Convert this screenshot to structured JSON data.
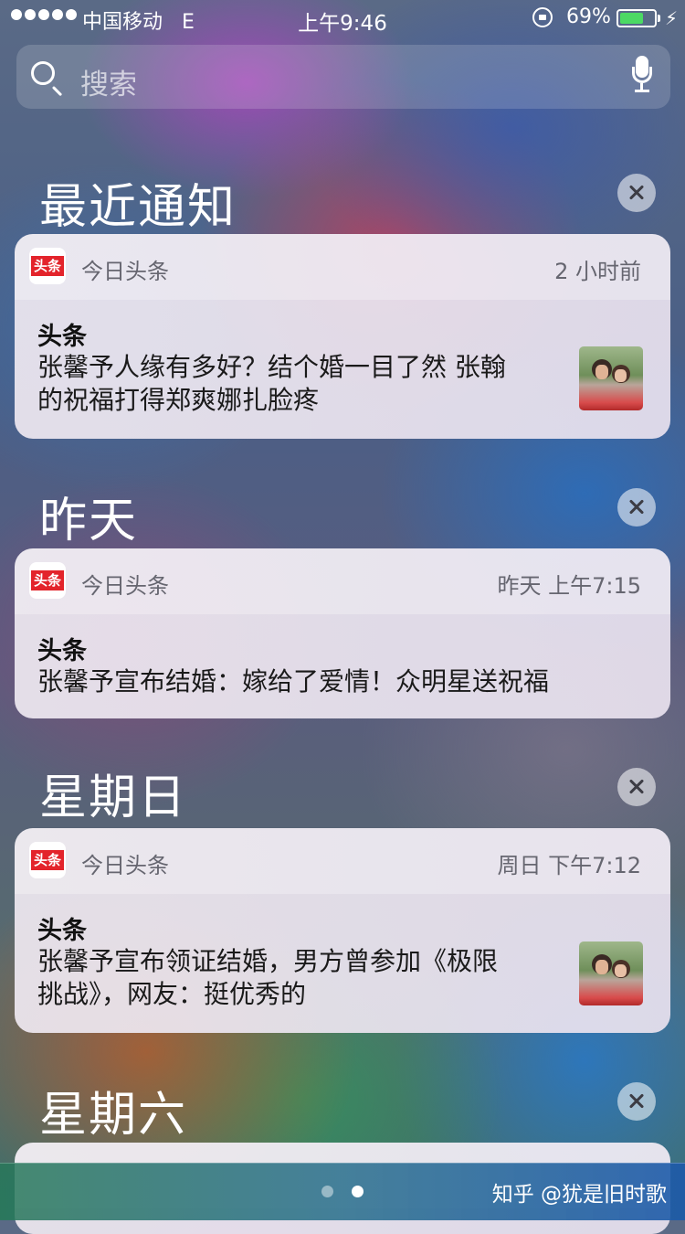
{
  "status_bar": {
    "carrier": "中国移动",
    "network": "E",
    "time": "上午9:46",
    "battery_percent": "69%",
    "battery_level": 0.69
  },
  "search": {
    "placeholder": "搜索"
  },
  "sections": [
    {
      "title": "最近通知",
      "card": {
        "app_name": "今日头条",
        "app_icon_text": "头条",
        "time": "2 小时前",
        "title": "头条",
        "body": [
          "张馨予人缘有多好？结个婚一目了然 张翰",
          "的祝福打得郑爽娜扎脸疼"
        ],
        "has_thumbnail": true
      }
    },
    {
      "title": "昨天",
      "card": {
        "app_name": "今日头条",
        "app_icon_text": "头条",
        "time": "昨天 上午7:15",
        "title": "头条",
        "body": [
          "张馨予宣布结婚：嫁给了爱情！众明星送祝福"
        ],
        "has_thumbnail": false
      }
    },
    {
      "title": "星期日",
      "card": {
        "app_name": "今日头条",
        "app_icon_text": "头条",
        "time": "周日 下午7:12",
        "title": "头条",
        "body": [
          "张馨予宣布领证结婚，男方曾参加《极限",
          "挑战》，网友：挺优秀的"
        ],
        "has_thumbnail": true
      }
    },
    {
      "title": "星期六"
    }
  ],
  "page_indicator": {
    "pages": 2,
    "current": 2
  },
  "watermark": "知乎 @犹是旧时歌"
}
